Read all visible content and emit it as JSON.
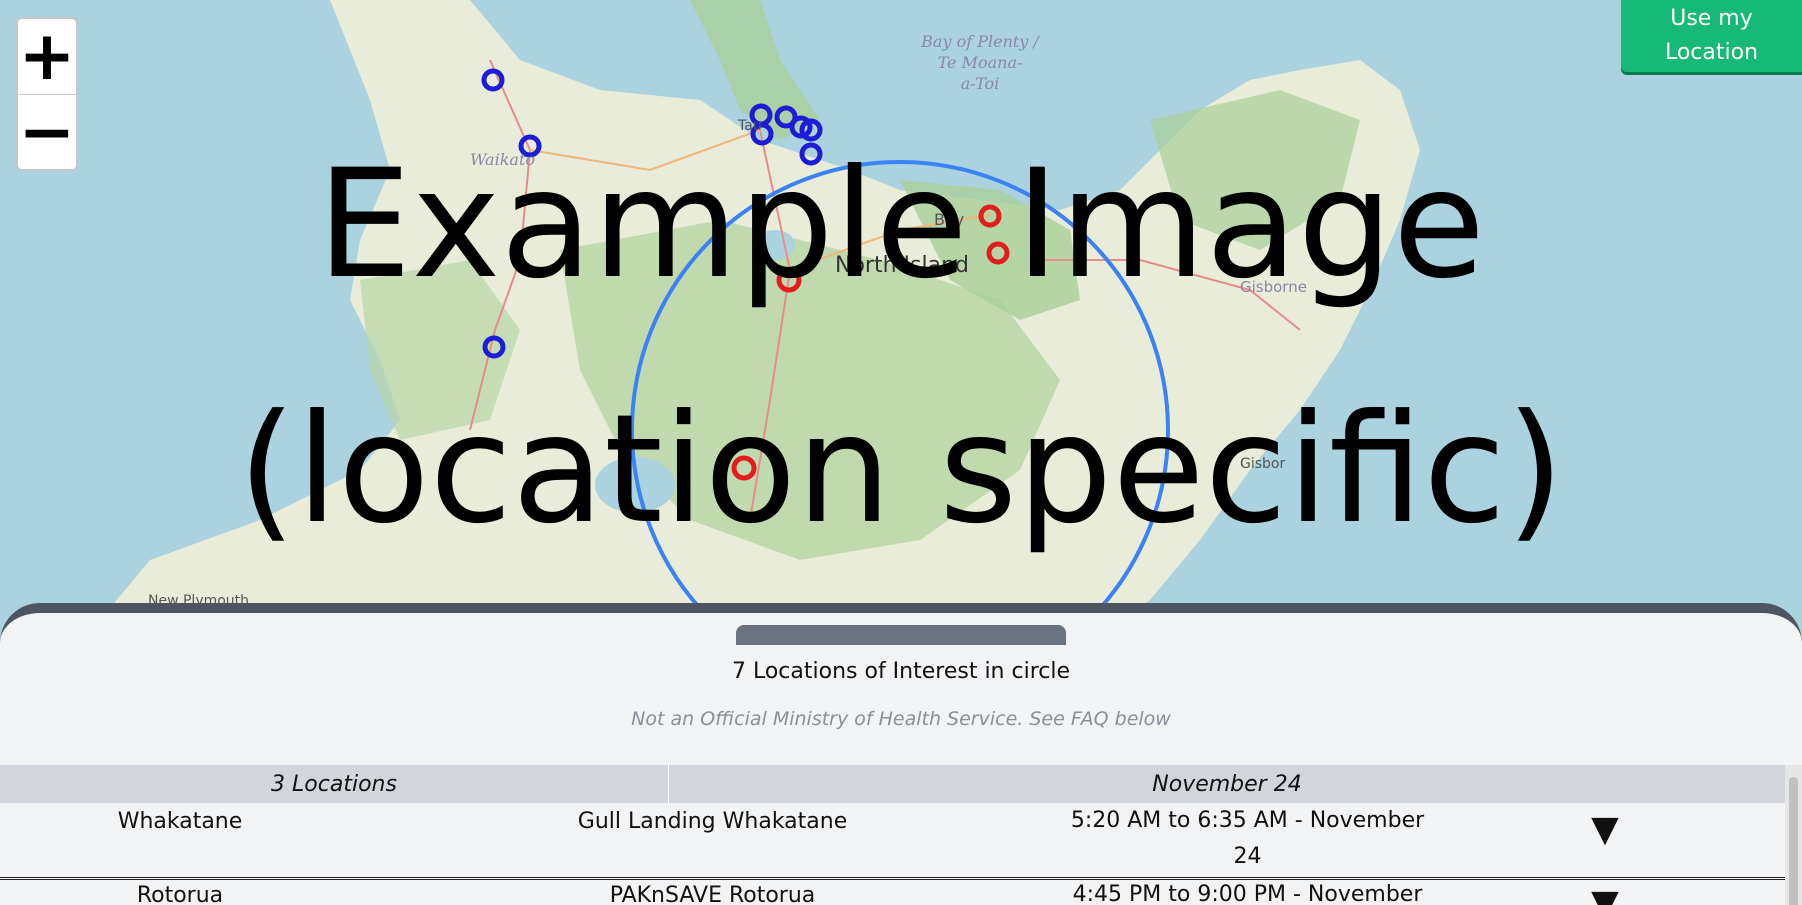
{
  "map": {
    "labels": {
      "bay_of_plenty": [
        "Bay of Plenty /",
        "Te Moana-",
        "a-Toi"
      ],
      "waikato": "Waikato",
      "tauranga": "Tau",
      "north_island": "North Island",
      "bay": "Bay",
      "gisborne": "Gisborne",
      "gisborne_short": "Gisbor",
      "new_plymouth": "New Plymouth"
    },
    "colors": {
      "water": "#aad3df",
      "land": "#e8ecd9",
      "forest": "#a9cf97",
      "circle": "#3b82f6",
      "marker_blue": "#1d1dd6",
      "marker_red": "#e11d1d"
    }
  },
  "zoom": {
    "in_label": "+",
    "out_label": "−"
  },
  "location_button": {
    "label": "Use my Location"
  },
  "overlay": {
    "line1": "Example Image",
    "line2": "(location specific)"
  },
  "panel": {
    "count_label": "7 Locations of Interest in circle",
    "disclaimer": "Not an Official Ministry of Health Service. See FAQ below",
    "group_header": {
      "locations": "3 Locations",
      "date": "November 24"
    },
    "rows": [
      {
        "location": "Whakatane",
        "place": "Gull Landing Whakatane",
        "time": "5:20 AM to 6:35 AM - November 24",
        "expand": "▼"
      },
      {
        "location": "Rotorua",
        "place": "PAKnSAVE Rotorua",
        "time": "4:45 PM to 9:00 PM - November",
        "expand": "▼"
      }
    ]
  }
}
